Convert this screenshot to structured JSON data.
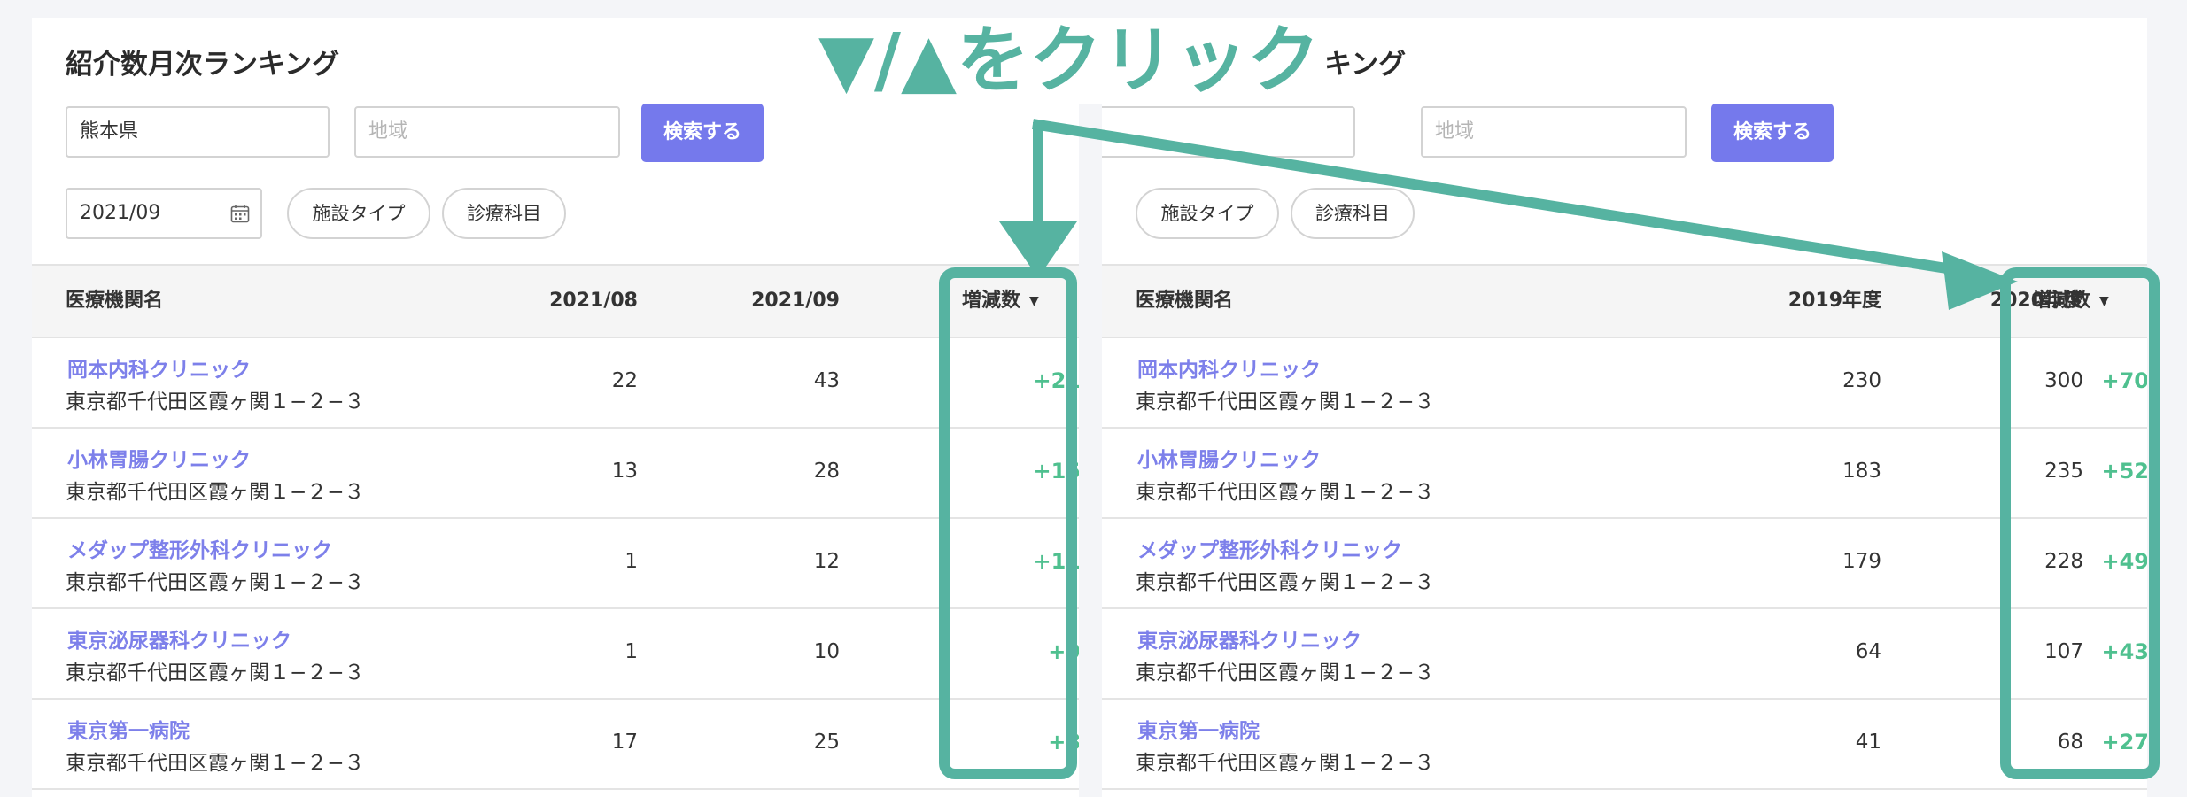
{
  "instruction": "▼/▲をクリック",
  "colors": {
    "accent_teal": "#56b3a1",
    "primary_button": "#7579ec",
    "link": "#7d80ea",
    "positive_diff": "#4fc08f"
  },
  "left_panel": {
    "title": "紹介数月次ランキング",
    "prefecture_value": "熊本県",
    "region_placeholder": "地域",
    "search_label": "検索する",
    "month_value": "2021/09",
    "facility_type_label": "施設タイプ",
    "department_label": "診療科目",
    "table": {
      "headers": {
        "name": "医療機関名",
        "col1": "2021/08",
        "col2": "2021/09",
        "diff": "増減数"
      },
      "sort_icon": "▼",
      "rows": [
        {
          "name": "岡本内科クリニック",
          "address": "東京都千代田区霞ヶ関１−２−３",
          "col1": "22",
          "col2": "43",
          "diff": "+21"
        },
        {
          "name": "小林胃腸クリニック",
          "address": "東京都千代田区霞ヶ関１−２−３",
          "col1": "13",
          "col2": "28",
          "diff": "+15"
        },
        {
          "name": "メダップ整形外科クリニック",
          "address": "東京都千代田区霞ヶ関１−２−３",
          "col1": "1",
          "col2": "12",
          "diff": "+11"
        },
        {
          "name": "東京泌尿器科クリニック",
          "address": "東京都千代田区霞ヶ関１−２−３",
          "col1": "1",
          "col2": "10",
          "diff": "+9"
        },
        {
          "name": "東京第一病院",
          "address": "東京都千代田区霞ヶ関１−２−３",
          "col1": "17",
          "col2": "25",
          "diff": "+8"
        }
      ]
    }
  },
  "right_panel": {
    "title_partial": "ンキング",
    "region_placeholder": "地域",
    "search_label": "検索する",
    "facility_type_label": "施設タイプ",
    "department_label": "診療科目",
    "table": {
      "headers": {
        "name": "医療機関名",
        "col1": "2019年度",
        "col2": "2020年度",
        "diff": "増減数"
      },
      "sort_icon": "▼",
      "rows": [
        {
          "name": "岡本内科クリニック",
          "address": "東京都千代田区霞ヶ関１−２−３",
          "col1": "230",
          "col2": "300",
          "diff": "+70"
        },
        {
          "name": "小林胃腸クリニック",
          "address": "東京都千代田区霞ヶ関１−２−３",
          "col1": "183",
          "col2": "235",
          "diff": "+52"
        },
        {
          "name": "メダップ整形外科クリニック",
          "address": "東京都千代田区霞ヶ関１−２−３",
          "col1": "179",
          "col2": "228",
          "diff": "+49"
        },
        {
          "name": "東京泌尿器科クリニック",
          "address": "東京都千代田区霞ヶ関１−２−３",
          "col1": "64",
          "col2": "107",
          "diff": "+43"
        },
        {
          "name": "東京第一病院",
          "address": "東京都千代田区霞ヶ関１−２−３",
          "col1": "41",
          "col2": "68",
          "diff": "+27"
        }
      ]
    }
  }
}
